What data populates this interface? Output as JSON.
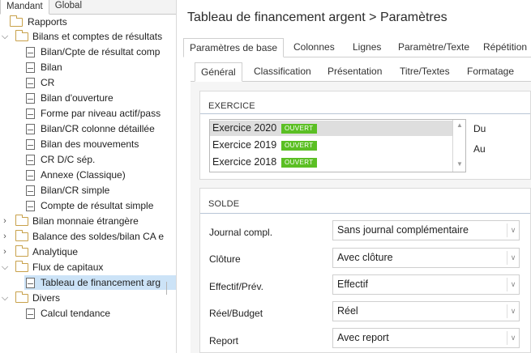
{
  "left_tabs": [
    "Mandant",
    "Global"
  ],
  "tree": {
    "root": "Rapports",
    "bilans": "Bilans et comptes de résultats",
    "bilans_items": [
      "Bilan/Cpte de résultat comp",
      "Bilan",
      "CR",
      "Bilan d'ouverture",
      "Forme par niveau actif/pass",
      "Bilan/CR colonne détaillée",
      "Bilan des mouvements",
      "CR D/C sép.",
      "Annexe (Classique)",
      "Bilan/CR simple",
      "Compte de résultat simple"
    ],
    "folders": [
      "Bilan monnaie étrangère",
      "Balance des soldes/bilan CA e",
      "Analytique"
    ],
    "flux": "Flux de capitaux",
    "flux_item": "Tableau de financement arg",
    "divers": "Divers",
    "divers_item": "Calcul tendance"
  },
  "title": "Tableau de financement argent > Paramètres",
  "main_tabs": [
    "Paramètres de base",
    "Colonnes",
    "Lignes",
    "Paramètre/Texte",
    "Répétition"
  ],
  "sub_tabs": [
    "Général",
    "Classification",
    "Présentation",
    "Titre/Textes",
    "Formatage"
  ],
  "exercice": {
    "header": "EXERCICE",
    "items": [
      {
        "label": "Exercice 2020",
        "status": "OUVERT"
      },
      {
        "label": "Exercice 2019",
        "status": "OUVERT"
      },
      {
        "label": "Exercice 2018",
        "status": "OUVERT"
      }
    ],
    "du_label": "Du",
    "au_label": "Au",
    "status_color": "#5bbf24"
  },
  "solde": {
    "header": "SOLDE",
    "fields": [
      {
        "label": "Journal compl.",
        "value": "Sans journal complémentaire"
      },
      {
        "label": "Clôture",
        "value": "Avec clôture"
      },
      {
        "label": "Effectif/Prév.",
        "value": "Effectif"
      },
      {
        "label": "Réel/Budget",
        "value": "Réel"
      },
      {
        "label": "Report",
        "value": "Avec report"
      }
    ]
  },
  "icons": {
    "folder": "folder-icon",
    "report": "report-document-icon",
    "expand": "chevron-right-icon",
    "collapse": "chevron-down-icon",
    "dropdown": "chevron-down-icon"
  }
}
